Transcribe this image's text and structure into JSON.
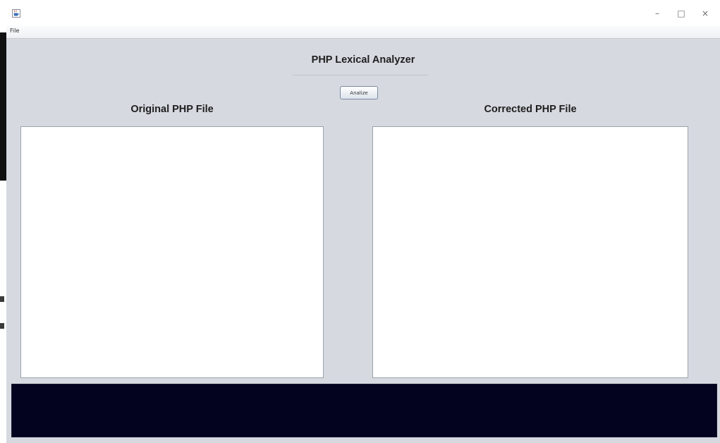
{
  "window": {
    "app_icon": "java-coffee-cup-icon",
    "controls": {
      "minimize": "–",
      "maximize": "□",
      "close": "×"
    }
  },
  "menubar": {
    "items": [
      {
        "label": "File"
      }
    ]
  },
  "main": {
    "title": "PHP Lexical Analyzer",
    "analize_button": "Analize",
    "original_label": "Original PHP File",
    "corrected_label": "Corrected PHP File",
    "original_text": "",
    "corrected_text": ""
  },
  "console": {
    "text": ""
  },
  "colors": {
    "window_bg": "#d6d9e0",
    "console_bg": "#03021f",
    "text_area_bg": "#ffffff"
  }
}
